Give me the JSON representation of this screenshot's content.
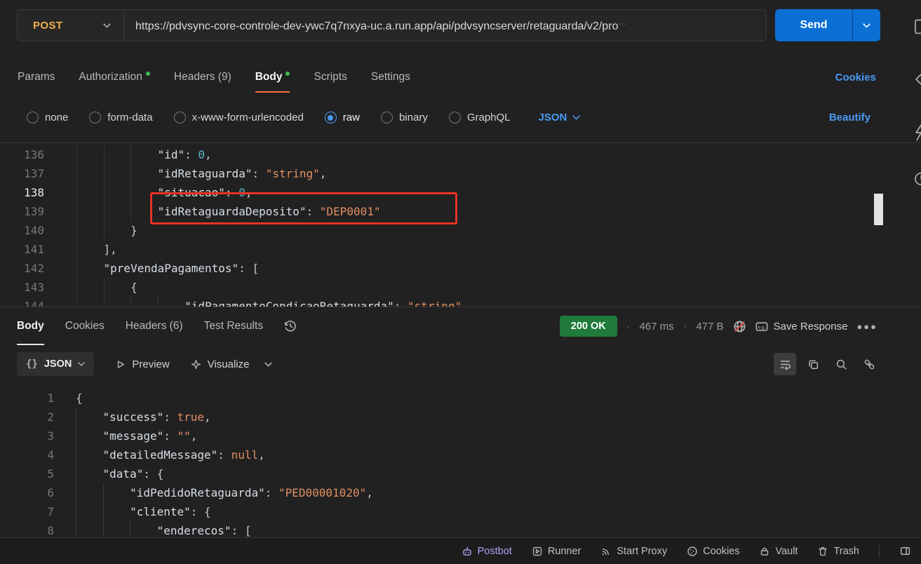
{
  "request": {
    "method": "POST",
    "url": "https://pdvsync-core-controle-dev-ywc7q7nxya-uc.a.run.app/api/pdvsyncserver/retaguarda/v2/pro",
    "url_truncation": "…",
    "send_label": "Send",
    "cookies_link": "Cookies",
    "beautify_link": "Beautify",
    "language": "JSON",
    "tabs": [
      {
        "label": "Params",
        "dot": false,
        "active": false
      },
      {
        "label": "Authorization",
        "dot": true,
        "active": false
      },
      {
        "label": "Headers (9)",
        "dot": false,
        "active": false
      },
      {
        "label": "Body",
        "dot": true,
        "active": true
      },
      {
        "label": "Scripts",
        "dot": false,
        "active": false
      },
      {
        "label": "Settings",
        "dot": false,
        "active": false
      }
    ],
    "modes": [
      {
        "label": "none",
        "selected": false
      },
      {
        "label": "form-data",
        "selected": false
      },
      {
        "label": "x-www-form-urlencoded",
        "selected": false
      },
      {
        "label": "raw",
        "selected": true
      },
      {
        "label": "binary",
        "selected": false
      },
      {
        "label": "GraphQL",
        "selected": false
      }
    ]
  },
  "request_editor": {
    "highlighted_line": "139",
    "lines": [
      {
        "num": "136",
        "indent": 12,
        "tokens": [
          [
            "key",
            "\"id\""
          ],
          [
            "pun",
            ": "
          ],
          [
            "num",
            "0"
          ],
          [
            "pun",
            ","
          ]
        ]
      },
      {
        "num": "137",
        "indent": 12,
        "tokens": [
          [
            "key",
            "\"idRetaguarda\""
          ],
          [
            "pun",
            ": "
          ],
          [
            "str",
            "\"string\""
          ],
          [
            "pun",
            ","
          ]
        ]
      },
      {
        "num": "138",
        "indent": 12,
        "active": true,
        "tokens": [
          [
            "key",
            "\"situacao\""
          ],
          [
            "pun",
            ": "
          ],
          [
            "num",
            "0"
          ],
          [
            "pun",
            ","
          ]
        ]
      },
      {
        "num": "139",
        "indent": 12,
        "tokens": [
          [
            "key",
            "\"idRetaguardaDeposito\""
          ],
          [
            "pun",
            ": "
          ],
          [
            "str",
            "\"DEP0001\""
          ]
        ]
      },
      {
        "num": "140",
        "indent": 8,
        "tokens": [
          [
            "pun",
            "}"
          ]
        ]
      },
      {
        "num": "141",
        "indent": 4,
        "tokens": [
          [
            "pun",
            "],"
          ]
        ]
      },
      {
        "num": "142",
        "indent": 4,
        "tokens": [
          [
            "key",
            "\"preVendaPagamentos\""
          ],
          [
            "pun",
            ": ["
          ]
        ]
      },
      {
        "num": "143",
        "indent": 8,
        "tokens": [
          [
            "pun",
            "{"
          ]
        ]
      },
      {
        "num": "144",
        "indent": 16,
        "tokens": [
          [
            "key",
            "\"idPagamentoCondicaoRetaguarda\""
          ],
          [
            "pun",
            ": "
          ],
          [
            "str",
            "\"string\""
          ]
        ]
      }
    ]
  },
  "response": {
    "tabs": [
      {
        "label": "Body",
        "active": true
      },
      {
        "label": "Cookies",
        "active": false
      },
      {
        "label": "Headers (6)",
        "active": false
      },
      {
        "label": "Test Results",
        "active": false
      }
    ],
    "status": "200 OK",
    "time": "467 ms",
    "size": "477 B",
    "save_label": "Save Response",
    "format_label": "JSON",
    "preview_label": "Preview",
    "visualize_label": "Visualize"
  },
  "response_editor": {
    "lines": [
      {
        "num": "1",
        "indent": 0,
        "tokens": [
          [
            "pun",
            "{"
          ]
        ]
      },
      {
        "num": "2",
        "indent": 4,
        "tokens": [
          [
            "key",
            "\"success\""
          ],
          [
            "pun",
            ": "
          ],
          [
            "kw",
            "true"
          ],
          [
            "pun",
            ","
          ]
        ]
      },
      {
        "num": "3",
        "indent": 4,
        "tokens": [
          [
            "key",
            "\"message\""
          ],
          [
            "pun",
            ": "
          ],
          [
            "str",
            "\"\""
          ],
          [
            "pun",
            ","
          ]
        ]
      },
      {
        "num": "4",
        "indent": 4,
        "tokens": [
          [
            "key",
            "\"detailedMessage\""
          ],
          [
            "pun",
            ": "
          ],
          [
            "kw",
            "null"
          ],
          [
            "pun",
            ","
          ]
        ]
      },
      {
        "num": "5",
        "indent": 4,
        "tokens": [
          [
            "key",
            "\"data\""
          ],
          [
            "pun",
            ": {"
          ]
        ]
      },
      {
        "num": "6",
        "indent": 8,
        "tokens": [
          [
            "key",
            "\"idPedidoRetaguarda\""
          ],
          [
            "pun",
            ": "
          ],
          [
            "str",
            "\"PED00001020\""
          ],
          [
            "pun",
            ","
          ]
        ]
      },
      {
        "num": "7",
        "indent": 8,
        "tokens": [
          [
            "key",
            "\"cliente\""
          ],
          [
            "pun",
            ": {"
          ]
        ]
      },
      {
        "num": "8",
        "indent": 12,
        "tokens": [
          [
            "key",
            "\"enderecos\""
          ],
          [
            "pun",
            ": ["
          ]
        ]
      }
    ]
  },
  "footer": {
    "items": [
      {
        "label": "Postbot"
      },
      {
        "label": "Runner"
      },
      {
        "label": "Start Proxy"
      },
      {
        "label": "Cookies"
      },
      {
        "label": "Vault"
      },
      {
        "label": "Trash"
      }
    ]
  },
  "icons": {
    "method-chevron": "chevron-down",
    "send-chevron": "chevron-down",
    "history": "clock-with-arrow",
    "network": "globe-with-red-slash",
    "save-example": "e.g. box",
    "more": "three-dots",
    "wrap-text": "lines-with-return-arrow",
    "copy": "two-squares",
    "search": "magnifier",
    "link": "chain",
    "preview": "play-outline",
    "visualize": "sparkle-star",
    "postbot": "robot",
    "runner": "play-in-square",
    "proxy": "signal-arcs",
    "cookies": "cookie",
    "vault": "padlock",
    "trash": "trash-can",
    "panel": "split-rectangle"
  },
  "colors": {
    "background": "#212121",
    "accent_blue": "#0b6fd4",
    "link_blue": "#4a9af5",
    "status_green": "#1f7a3b",
    "dot_green": "#3fb950",
    "highlight_red": "#e93223",
    "active_tab_orange": "#ff6c37",
    "method_post": "#f0b14e",
    "string_orange": "#e08f62",
    "number_teal": "#5bb8c9",
    "postbot_purple": "#ab9ff2"
  }
}
